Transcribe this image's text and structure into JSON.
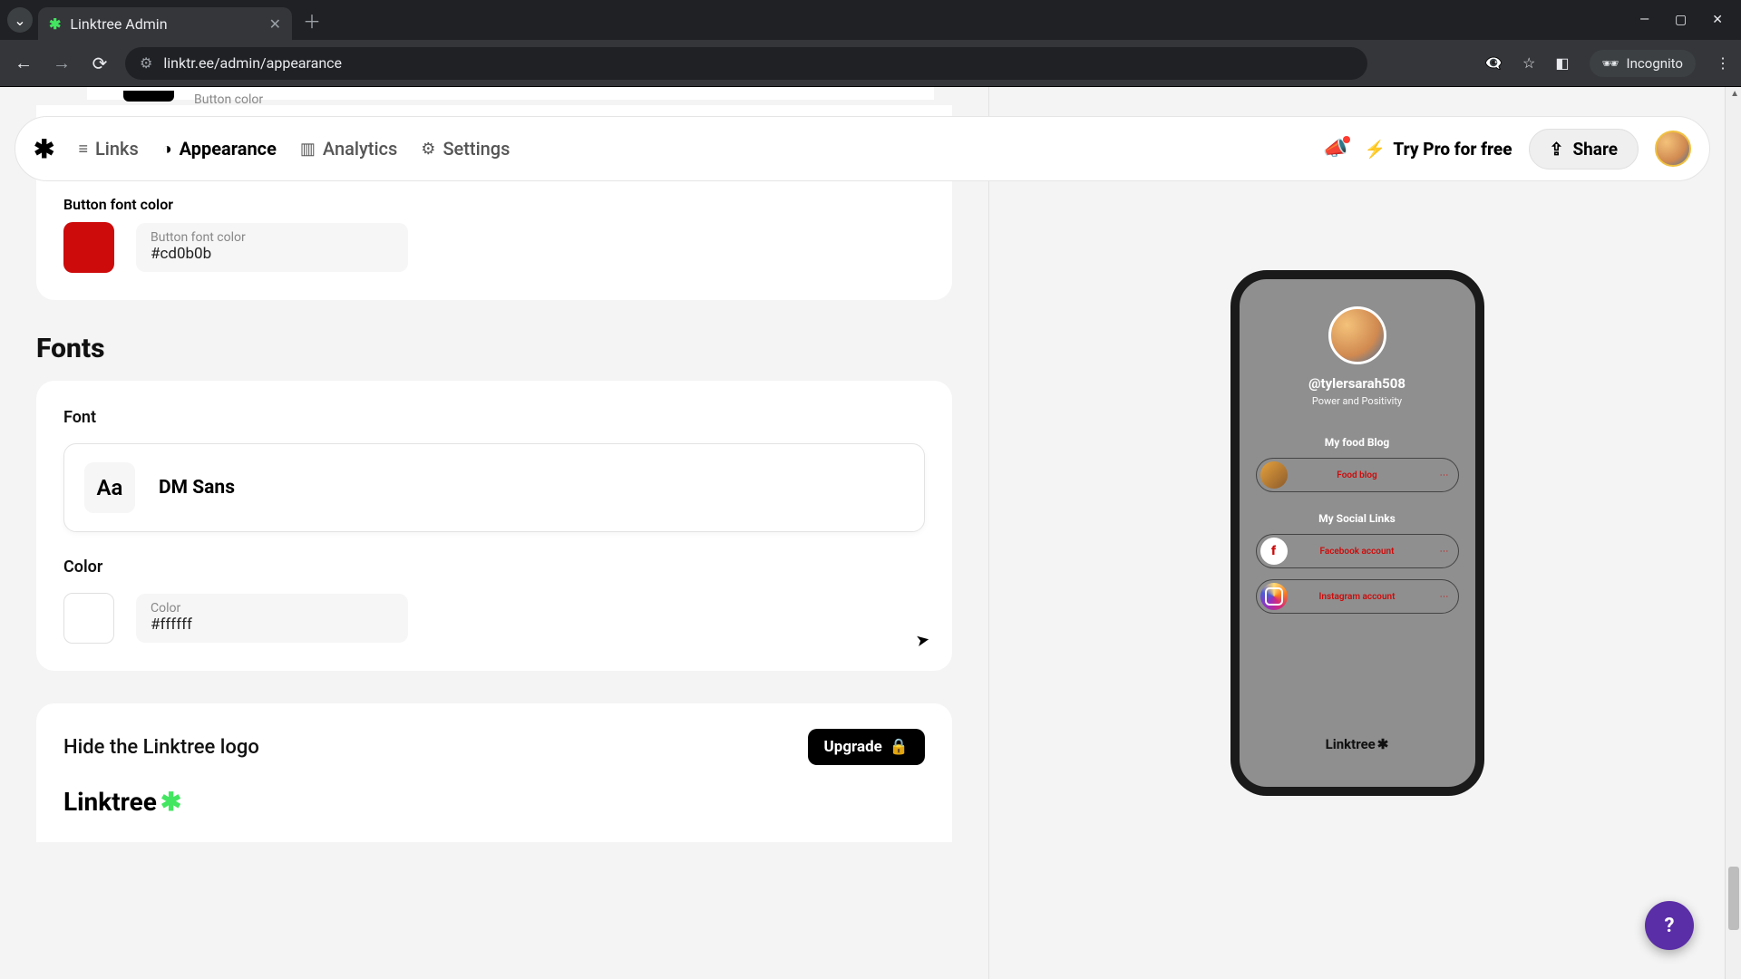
{
  "browser": {
    "tab_title": "Linktree Admin",
    "url": "linktr.ee/admin/appearance",
    "incognito_label": "Incognito"
  },
  "header": {
    "nav": {
      "links": "Links",
      "appearance": "Appearance",
      "analytics": "Analytics",
      "settings": "Settings"
    },
    "try_pro": "Try Pro for free",
    "share": "Share"
  },
  "button_color_peek_label": "Button color",
  "button_font_color": {
    "section_label": "Button font color",
    "field_label": "Button font color",
    "value": "#cd0b0b"
  },
  "fonts": {
    "title": "Fonts",
    "font_label": "Font",
    "font_chip": "Aa",
    "font_name": "DM Sans",
    "color_label": "Color",
    "color_field_label": "Color",
    "color_value": "#ffffff"
  },
  "hide_logo": {
    "title": "Hide the Linktree logo",
    "upgrade": "Upgrade",
    "wordmark": "Linktree"
  },
  "preview": {
    "handle": "@tylersarah508",
    "tagline": "Power and Positivity",
    "section1": "My food Blog",
    "link1": "Food blog",
    "section2": "My Social Links",
    "link2": "Facebook account",
    "link3": "Instagram account",
    "footer": "Linktree"
  },
  "help": "?"
}
